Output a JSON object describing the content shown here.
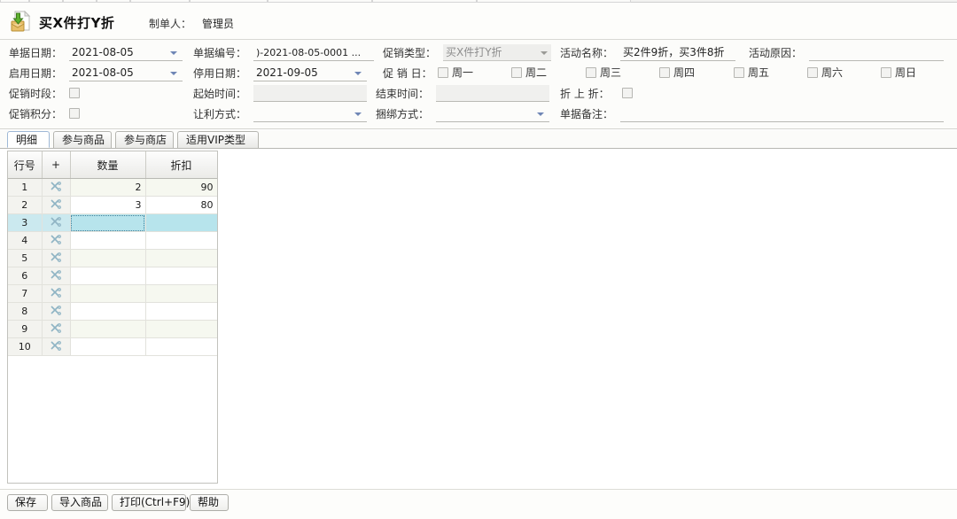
{
  "header": {
    "icon": "import-document-icon",
    "title": "买X件打Y折",
    "maker_label": "制单人：",
    "maker_value": "管理员"
  },
  "form": {
    "doc_date": {
      "label": "单据日期：",
      "value": "2021-08-05",
      "icon": "chevron-down-icon"
    },
    "doc_no": {
      "label": "单据编号：",
      "value": ")-2021-08-05-0001 ..."
    },
    "promo_type": {
      "label": "促销类型：",
      "value": "买X件打Y折",
      "icon": "chevron-down-icon"
    },
    "activity_name": {
      "label": "活动名称：",
      "value": "买2件9折，买3件8折"
    },
    "activity_reason": {
      "label": "活动原因：",
      "value": ""
    },
    "start_date": {
      "label": "启用日期：",
      "value": "2021-08-05",
      "icon": "chevron-down-icon"
    },
    "stop_date": {
      "label": "停用日期：",
      "value": "2021-09-05",
      "icon": "chevron-down-icon"
    },
    "promo_day": {
      "label": "促 销 日："
    },
    "weekdays": [
      {
        "label": "周一",
        "checked": false
      },
      {
        "label": "周二",
        "checked": false
      },
      {
        "label": "周三",
        "checked": false
      },
      {
        "label": "周四",
        "checked": false
      },
      {
        "label": "周五",
        "checked": false
      },
      {
        "label": "周六",
        "checked": false
      },
      {
        "label": "周日",
        "checked": false
      }
    ],
    "promo_period": {
      "label": "促销时段：",
      "checked": false
    },
    "start_time": {
      "label": "起始时间：",
      "value": ""
    },
    "end_time": {
      "label": "结束时间：",
      "value": ""
    },
    "extra_discount": {
      "label": "折 上  折：",
      "checked": false
    },
    "promo_points": {
      "label": "促销积分：",
      "checked": false
    },
    "profit_mode": {
      "label": "让利方式：",
      "value": "",
      "icon": "chevron-down-icon"
    },
    "bundle_mode": {
      "label": "捆绑方式：",
      "value": "",
      "icon": "chevron-down-icon"
    },
    "doc_remark": {
      "label": "单据备注：",
      "value": ""
    }
  },
  "tabs": [
    {
      "label": "明细",
      "active": true
    },
    {
      "label": "参与商品",
      "active": false
    },
    {
      "label": "参与商店",
      "active": false
    },
    {
      "label": "适用VIP类型",
      "active": false
    }
  ],
  "grid": {
    "columns": [
      "行号",
      "+",
      "数量",
      "折扣"
    ],
    "rows": [
      {
        "no": "1",
        "icon": "scissors-icon",
        "qty": "2",
        "discount": "90"
      },
      {
        "no": "2",
        "icon": "scissors-icon",
        "qty": "3",
        "discount": "80"
      },
      {
        "no": "3",
        "icon": "scissors-icon",
        "qty": "",
        "discount": ""
      },
      {
        "no": "4",
        "icon": "scissors-icon",
        "qty": "",
        "discount": ""
      },
      {
        "no": "5",
        "icon": "scissors-icon",
        "qty": "",
        "discount": ""
      },
      {
        "no": "6",
        "icon": "scissors-icon",
        "qty": "",
        "discount": ""
      },
      {
        "no": "7",
        "icon": "scissors-icon",
        "qty": "",
        "discount": ""
      },
      {
        "no": "8",
        "icon": "scissors-icon",
        "qty": "",
        "discount": ""
      },
      {
        "no": "9",
        "icon": "scissors-icon",
        "qty": "",
        "discount": ""
      },
      {
        "no": "10",
        "icon": "scissors-icon",
        "qty": "",
        "discount": ""
      }
    ],
    "selected_row": 3,
    "editing_cell": "qty"
  },
  "buttons": [
    {
      "label": "保存"
    },
    {
      "label": "导入商品"
    },
    {
      "label": "打印(Ctrl+F9)"
    },
    {
      "label": "帮助"
    }
  ],
  "colors": {
    "selection": "#b7e4ec",
    "alt_row": "#f6f8f0",
    "panel_bg": "#fcfcfa",
    "caret": "#6f86b5"
  }
}
